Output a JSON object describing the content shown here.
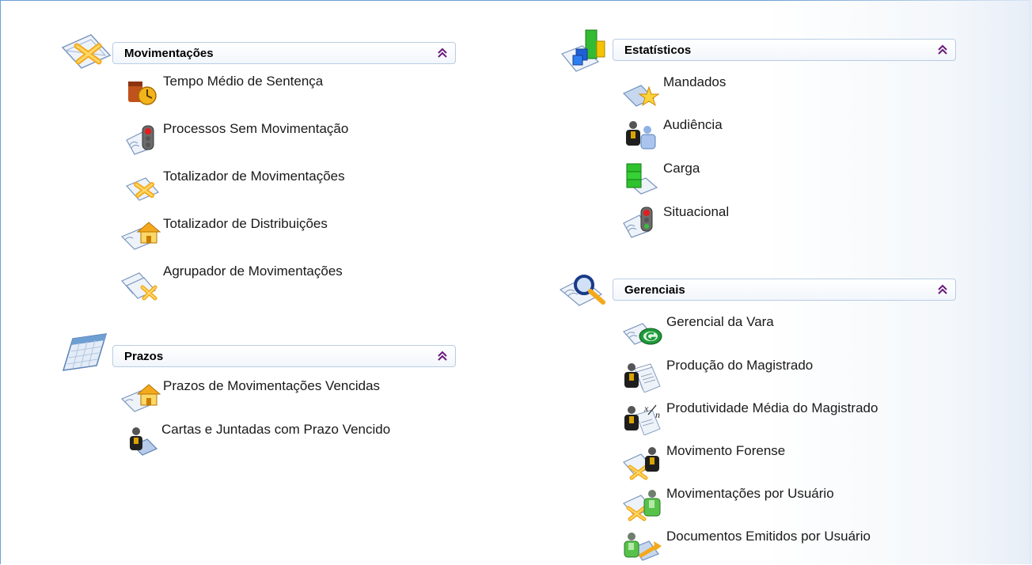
{
  "sections": {
    "movimentacoes": {
      "title": "Movimentações",
      "items": [
        {
          "label": "Tempo Médio de Sentença",
          "icon": "clock-gavel-icon"
        },
        {
          "label": "Processos Sem Movimentação",
          "icon": "traffic-light-document-icon"
        },
        {
          "label": "Totalizador de Movimentações",
          "icon": "arrows-document-icon"
        },
        {
          "label": "Totalizador de Distribuições",
          "icon": "house-document-icon"
        },
        {
          "label": "Agrupador de Movimentações",
          "icon": "grouped-arrows-document-icon"
        }
      ]
    },
    "prazos": {
      "title": "Prazos",
      "items": [
        {
          "label": "Prazos de Movimentações Vencidas",
          "icon": "house-document-icon"
        },
        {
          "label": "Cartas e Juntadas com Prazo Vencido",
          "icon": "person-envelope-icon"
        }
      ]
    },
    "estatisticos": {
      "title": "Estatísticos",
      "items": [
        {
          "label": "Mandados",
          "icon": "star-document-icon"
        },
        {
          "label": "Audiência",
          "icon": "two-people-icon"
        },
        {
          "label": "Carga",
          "icon": "green-stack-document-icon"
        },
        {
          "label": "Situacional",
          "icon": "traffic-light-document-icon"
        }
      ]
    },
    "gerenciais": {
      "title": "Gerenciais",
      "items": [
        {
          "label": "Gerencial da Vara",
          "icon": "green-g-document-icon"
        },
        {
          "label": "Produção do Magistrado",
          "icon": "person-documents-icon"
        },
        {
          "label": "Produtividade Média do Magistrado",
          "icon": "person-average-icon"
        },
        {
          "label": "Movimento Forense",
          "icon": "person-arrows-icon"
        },
        {
          "label": "Movimentações por Usuário",
          "icon": "user-arrows-document-icon"
        },
        {
          "label": "Documentos Emitidos por Usuário",
          "icon": "user-document-arrow-icon"
        }
      ]
    }
  },
  "colors": {
    "frame_border": "#6e9fd3",
    "bar_border": "#b9cde3",
    "collapse_icon": "#6a1a7a"
  }
}
